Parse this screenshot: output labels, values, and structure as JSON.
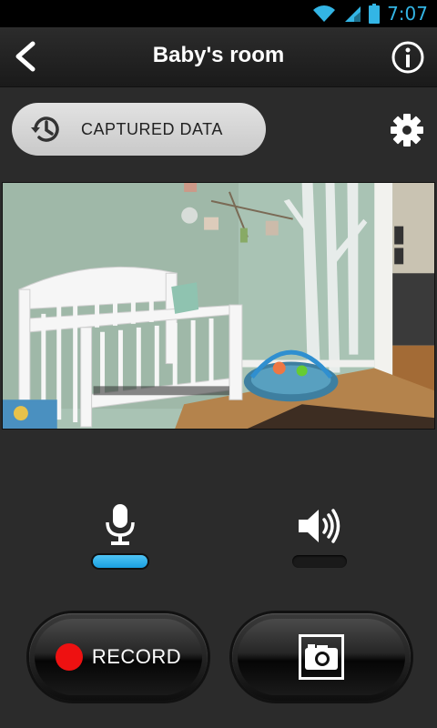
{
  "status_bar": {
    "time": "7:07"
  },
  "header": {
    "title": "Baby's room"
  },
  "captured_data": {
    "label": "CAPTURED DATA"
  },
  "audio": {
    "mic_active": true,
    "speaker_active": false
  },
  "controls": {
    "record_label": "RECORD"
  },
  "colors": {
    "accent": "#33b5e5",
    "indicator_active": "#1a9fe0",
    "record_red": "#ee1111",
    "background": "#2b2b2b"
  },
  "icons": [
    "back-arrow-icon",
    "info-icon",
    "history-clock-icon",
    "gear-icon",
    "microphone-icon",
    "speaker-icon",
    "camera-icon",
    "wifi-icon",
    "signal-icon",
    "battery-icon"
  ]
}
